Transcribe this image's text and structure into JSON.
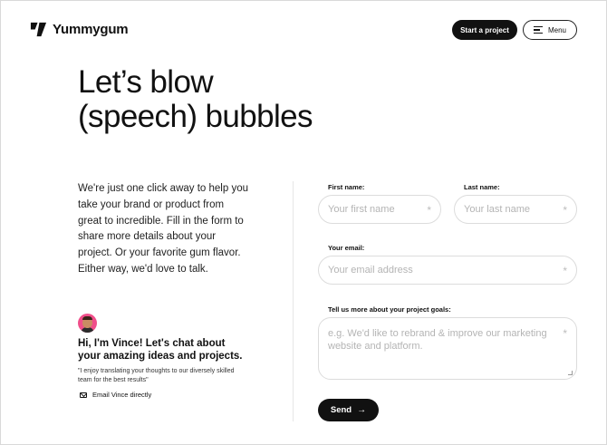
{
  "header": {
    "brand": "Yummygum",
    "start_label": "Start a project",
    "menu_label": "Menu"
  },
  "hero": {
    "line1": "Let’s blow",
    "line2": "(speech) bubbles"
  },
  "intro": {
    "text": "We're just one click away to help you take your brand or product from great to incredible. Fill in the form to share more details about your project. Or your favorite gum flavor. Either way, we'd love to talk."
  },
  "contact": {
    "title": "Hi, I'm Vince! Let's chat about your amazing ideas and projects.",
    "quote": "\"I enjoy translating your thoughts to our diversely skilled team for the best results\"",
    "email_label": "Email Vince directly"
  },
  "form": {
    "first_name": {
      "label": "First name:",
      "placeholder": "Your first name",
      "value": ""
    },
    "last_name": {
      "label": "Last name:",
      "placeholder": "Your last name",
      "value": ""
    },
    "email": {
      "label": "Your email:",
      "placeholder": "Your email address",
      "value": ""
    },
    "goals": {
      "label": "Tell us more about your project goals:",
      "placeholder": "e.g. We'd like to rebrand & improve our marketing website and platform.",
      "value": ""
    },
    "required_mark": "*",
    "send_label": "Send",
    "send_arrow": "→"
  },
  "colors": {
    "primary": "#111111",
    "background": "#ffffff",
    "field_border": "#dcdcdc",
    "placeholder": "#b4b4b4",
    "avatar_bg": "#f04e8a"
  },
  "icons": {
    "logo": "yummygum-logo-icon",
    "menu": "hamburger-icon",
    "mail": "mail-icon",
    "send": "arrow-right-icon"
  }
}
